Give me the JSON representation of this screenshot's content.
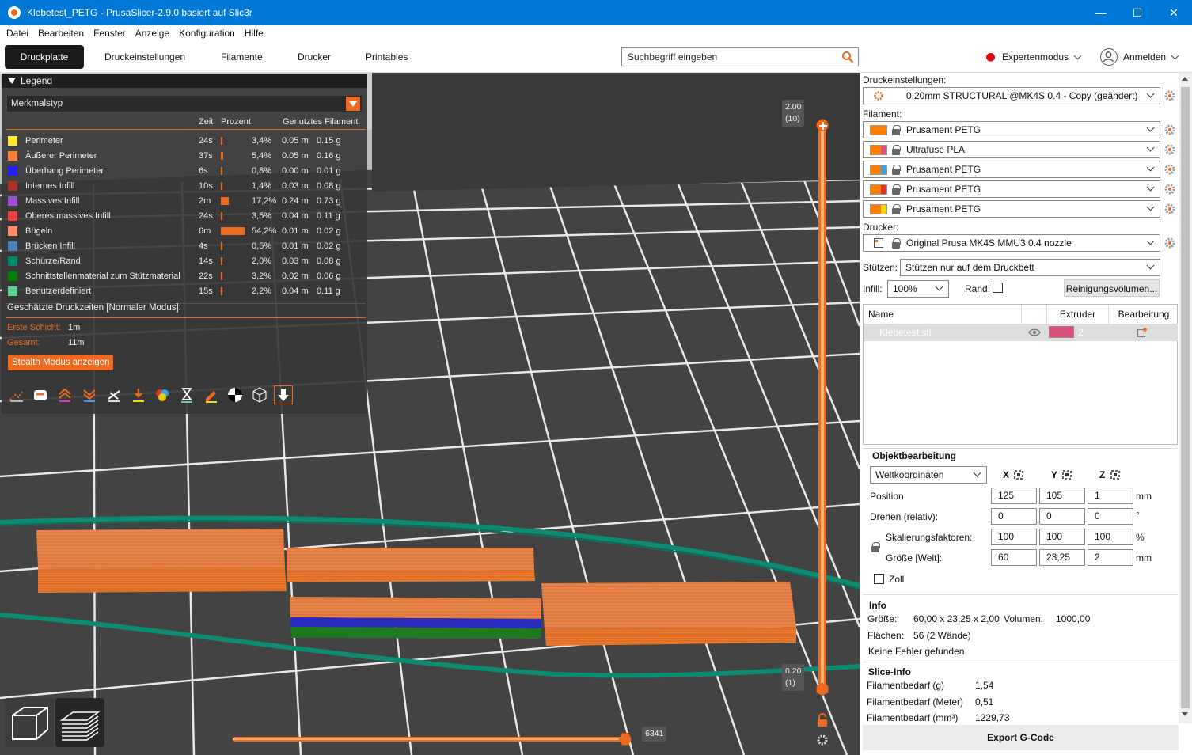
{
  "window": {
    "title": "Klebetest_PETG - PrusaSlicer-2.9.0 basiert auf Slic3r",
    "minimize": "—",
    "maximize": "☐",
    "close": "✕"
  },
  "menu": [
    "Datei",
    "Bearbeiten",
    "Fenster",
    "Anzeige",
    "Konfiguration",
    "Hilfe"
  ],
  "tabs": [
    "Druckplatte",
    "Druckeinstellungen",
    "Filamente",
    "Drucker",
    "Printables"
  ],
  "search": {
    "placeholder": "Suchbegriff eingeben"
  },
  "mode": {
    "label": "Expertenmodus",
    "color": "#e30613"
  },
  "account": {
    "label": "Anmelden"
  },
  "legend": {
    "title": "Legend",
    "view_type": "Merkmalstyp",
    "columns": {
      "time": "Zeit",
      "percent": "Prozent",
      "filament": "Genutztes Filament"
    },
    "rows": [
      {
        "name": "Perimeter",
        "time": "24s",
        "percent": "3,4%",
        "pct": 3.4,
        "meters": "0.05 m",
        "grams": "0.15 g",
        "color": "#ffe633"
      },
      {
        "name": "Äußerer Perimeter",
        "time": "37s",
        "percent": "5,4%",
        "pct": 5.4,
        "meters": "0.05 m",
        "grams": "0.16 g",
        "color": "#ff7d38"
      },
      {
        "name": "Überhang Perimeter",
        "time": "6s",
        "percent": "0,8%",
        "pct": 0.8,
        "meters": "0.00 m",
        "grams": "0.01 g",
        "color": "#1f1fff"
      },
      {
        "name": "Internes Infill",
        "time": "10s",
        "percent": "1,4%",
        "pct": 1.4,
        "meters": "0.03 m",
        "grams": "0.08 g",
        "color": "#b03029"
      },
      {
        "name": "Massives Infill",
        "time": "2m",
        "percent": "17,2%",
        "pct": 17.2,
        "meters": "0.24 m",
        "grams": "0.73 g",
        "color": "#9654cc"
      },
      {
        "name": "Oberes massives Infill",
        "time": "24s",
        "percent": "3,5%",
        "pct": 3.5,
        "meters": "0.04 m",
        "grams": "0.11 g",
        "color": "#f04040"
      },
      {
        "name": "Bügeln",
        "time": "6m",
        "percent": "54,2%",
        "pct": 54.2,
        "meters": "0.01 m",
        "grams": "0.02 g",
        "color": "#ff8c69"
      },
      {
        "name": "Brücken Infill",
        "time": "4s",
        "percent": "0,5%",
        "pct": 0.5,
        "meters": "0.01 m",
        "grams": "0.02 g",
        "color": "#4d80ba"
      },
      {
        "name": "Schürze/Rand",
        "time": "14s",
        "percent": "2,0%",
        "pct": 2.0,
        "meters": "0.03 m",
        "grams": "0.08 g",
        "color": "#00876e"
      },
      {
        "name": "Schnittstellenmaterial zum Stützmaterial",
        "time": "22s",
        "percent": "3,2%",
        "pct": 3.2,
        "meters": "0.02 m",
        "grams": "0.06 g",
        "color": "#008000"
      },
      {
        "name": "Benutzerdefiniert",
        "time": "15s",
        "percent": "2,2%",
        "pct": 2.2,
        "meters": "0.04 m",
        "grams": "0.11 g",
        "color": "#5ed194"
      }
    ],
    "estimate_title": "Geschätzte Druckzeiten [Normaler Modus]:",
    "first_layer_label": "Erste Schicht:",
    "first_layer_value": "1m",
    "total_label": "Gesamt:",
    "total_value": "11m",
    "stealth_button": "Stealth Modus anzeigen",
    "tools": [
      "travel-icon",
      "wipe-icon",
      "retract-icon",
      "deretract-icon",
      "seam-icon",
      "tool-change-icon",
      "color-change-icon",
      "pause-icon",
      "custom-gcode-icon",
      "center-of-gravity-icon",
      "shells-icon",
      "tool-marker-icon"
    ]
  },
  "slider": {
    "top_value": "2.00",
    "top_layer": "(10)",
    "bottom_value": "0.20",
    "bottom_layer": "(1)",
    "horizontal_value": "6341"
  },
  "panel": {
    "print_settings_label": "Druckeinstellungen:",
    "print_profile": "0.20mm STRUCTURAL @MK4S 0.4 - Copy (geändert)",
    "filament_label": "Filament:",
    "filaments": [
      {
        "name": "Prusament PETG",
        "color": "#ff8000",
        "accent": "#ff8000"
      },
      {
        "name": "Ultrafuse PLA",
        "color": "#ff8000",
        "accent": "#d9507a"
      },
      {
        "name": "Prusament PETG",
        "color": "#ff8000",
        "accent": "#3aa0e0"
      },
      {
        "name": "Prusament PETG",
        "color": "#ff8000",
        "accent": "#e03030"
      },
      {
        "name": "Prusament PETG",
        "color": "#ff8000",
        "accent": "#ffd700"
      }
    ],
    "printer_label": "Drucker:",
    "printer": "Original Prusa MK4S MMU3 0.4 nozzle",
    "supports_label": "Stützen:",
    "supports": "Stützen nur auf dem Druckbett",
    "infill_label": "Infill:",
    "infill": "100%",
    "brim_label": "Rand:",
    "purge_button": "Reinigungsvolumen...",
    "objects": {
      "col_name": "Name",
      "col_extruder": "Extruder",
      "col_edit": "Bearbeitung",
      "rows": [
        {
          "name": "Klebetest.stl",
          "extruder": "2",
          "color": "#d9507a"
        }
      ]
    },
    "manipulation": {
      "title": "Objektbearbeitung",
      "coords": "Weltkoordinaten",
      "x": "X",
      "y": "Y",
      "z": "Z",
      "position_label": "Position:",
      "position": [
        "125",
        "105",
        "1"
      ],
      "position_unit": "mm",
      "rotate_label": "Drehen (relativ):",
      "rotate": [
        "0",
        "0",
        "0"
      ],
      "rotate_unit": "°",
      "scale_label": "Skalierungsfaktoren:",
      "scale": [
        "100",
        "100",
        "100"
      ],
      "scale_unit": "%",
      "size_label": "Größe [Welt]:",
      "size": [
        "60",
        "23,25",
        "2"
      ],
      "size_unit": "mm",
      "inch_label": "Zoll"
    },
    "info": {
      "title": "Info",
      "size_label": "Größe:",
      "size": "60,00 x 23,25 x 2,00",
      "volume_label": "Volumen:",
      "volume": "1000,00",
      "facets_label": "Flächen:",
      "facets": "56 (2 Wände)",
      "errors": "Keine Fehler gefunden"
    },
    "slice_info": {
      "title": "Slice-Info",
      "rows": [
        {
          "label": "Filamentbedarf (g)",
          "value": "1,54"
        },
        {
          "label": "Filamentbedarf (Meter)",
          "value": "0,51"
        },
        {
          "label": "Filamentbedarf (mm³)",
          "value": "1229,73"
        }
      ]
    },
    "export_button": "Export G-Code"
  }
}
